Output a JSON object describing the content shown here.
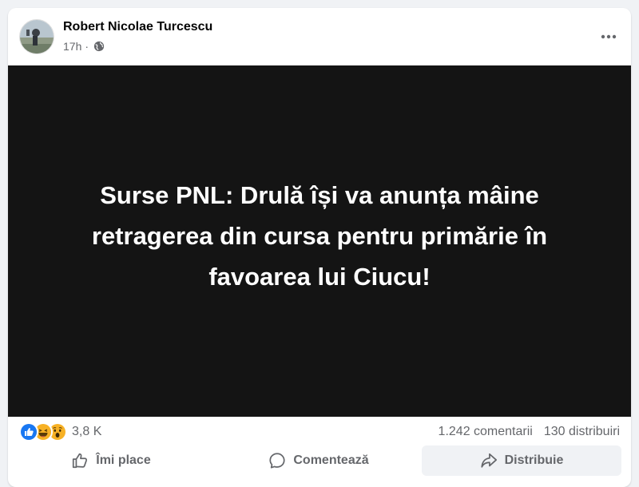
{
  "post": {
    "author": "Robert Nicolae Turcescu",
    "time": "17h",
    "separator": "·",
    "visibility_icon": "globe-icon",
    "more_icon": "more-horizontal-icon",
    "headline_lines": [
      "Surse PNL: Drulă își va anunța mâine",
      "retragerea din cursa pentru primărie în",
      "favoarea lui Ciucu!"
    ]
  },
  "reactions": {
    "icons": [
      "like-reaction-icon",
      "haha-reaction-icon",
      "wow-reaction-icon"
    ],
    "count": "3,8 K"
  },
  "stats": {
    "comments": "1.242 comentarii",
    "shares": "130 distribuiri"
  },
  "actions": {
    "like": "Îmi place",
    "comment": "Comentează",
    "share": "Distribuie"
  },
  "colors": {
    "media_background": "#141414",
    "like_blue": "#1877f2",
    "emoji_yellow": "#f7b125",
    "secondary_text": "#65676b"
  }
}
